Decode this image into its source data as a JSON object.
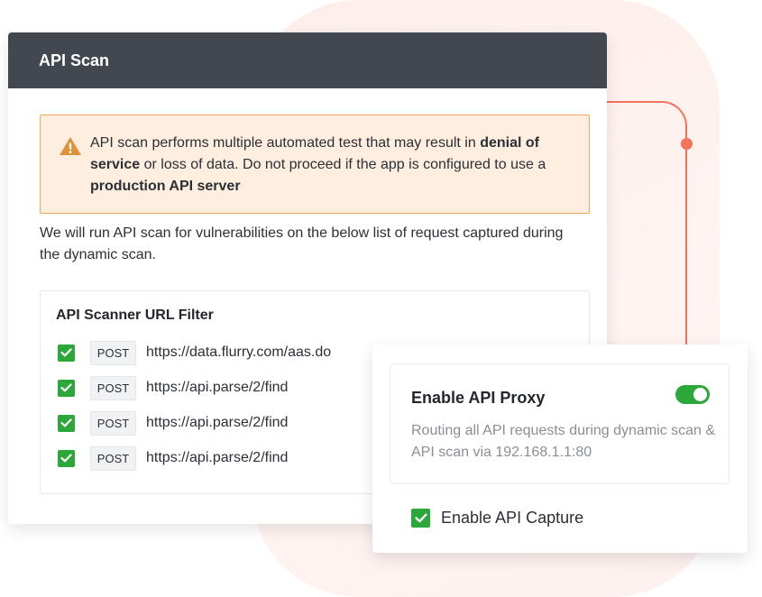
{
  "colors": {
    "accent_green": "#2ca83a",
    "connector": "#f5735b",
    "header_bg": "#434850",
    "warning_bg": "#fdeedf",
    "warning_border": "#f2a65b",
    "warning_icon": "#e0913c"
  },
  "scan": {
    "title": "API Scan",
    "warning": {
      "icon": "warning-triangle-icon",
      "text_1": "API scan performs multiple automated test that may result in ",
      "bold_1": "denial of service",
      "text_2": " or loss of data. Do not proceed if the app is configured to use a ",
      "bold_2": "production API server"
    },
    "intro": "We will run API scan for vulnerabilities on the below list of request captured during the dynamic scan.",
    "filter": {
      "title": "API Scanner URL Filter",
      "rows": [
        {
          "checked": true,
          "method": "POST",
          "url": "https://data.flurry.com/aas.do"
        },
        {
          "checked": true,
          "method": "POST",
          "url": "https://api.parse/2/find"
        },
        {
          "checked": true,
          "method": "POST",
          "url": "https://api.parse/2/find"
        },
        {
          "checked": true,
          "method": "POST",
          "url": "https://api.parse/2/find"
        }
      ]
    }
  },
  "proxy": {
    "title": "Enable API Proxy",
    "toggle_on": true,
    "description": "Routing all API requests during dynamic scan & API scan via 192.168.1.1:80",
    "capture_checked": true,
    "capture_label": "Enable API Capture"
  }
}
